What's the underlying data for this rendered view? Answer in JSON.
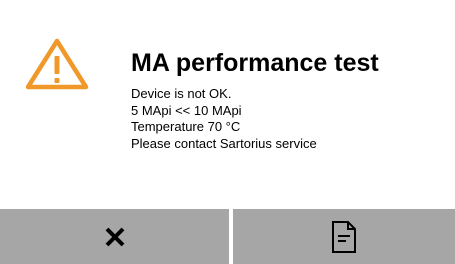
{
  "dialog": {
    "icon": "warning-icon",
    "title": "MA performance test",
    "message_lines": [
      "Device is not OK.",
      "5 MApi << 10 MApi",
      "Temperature 70 °C",
      "Please contact Sartorius service"
    ],
    "accent_color": "#f0992a"
  },
  "buttons": {
    "close_icon": "close-icon",
    "document_icon": "document-icon",
    "background_color": "#a6a6a6"
  }
}
